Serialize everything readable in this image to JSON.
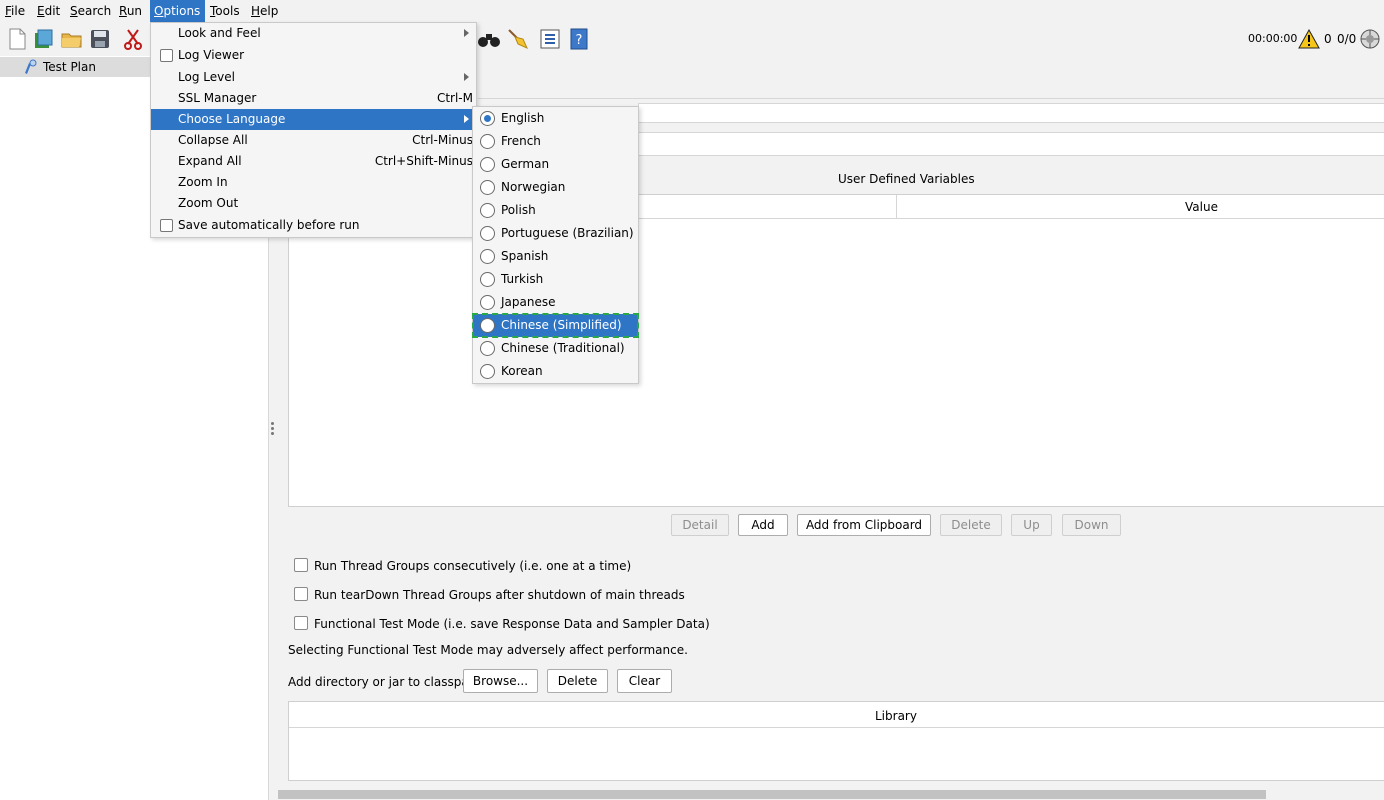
{
  "menubar": {
    "items": [
      {
        "mnemonic": "F",
        "rest": "ile"
      },
      {
        "mnemonic": "E",
        "rest": "dit"
      },
      {
        "mnemonic": "S",
        "rest": "earch"
      },
      {
        "mnemonic": "R",
        "rest": "un"
      },
      {
        "mnemonic": "O",
        "rest": "ptions"
      },
      {
        "mnemonic": "T",
        "rest": "ools"
      },
      {
        "mnemonic": "H",
        "rest": "elp"
      }
    ]
  },
  "status": {
    "timer": "00:00:00",
    "warnings": "0",
    "threads": "0/0"
  },
  "tree": {
    "root": "Test Plan"
  },
  "options_menu": {
    "items": [
      {
        "label": "Look and Feel",
        "accel": "",
        "submenu": true
      },
      {
        "label": "Log Viewer",
        "accel": "",
        "checkbox": true
      },
      {
        "label": "Log Level",
        "accel": "",
        "submenu": true
      },
      {
        "label": "SSL Manager",
        "accel": "Ctrl-M"
      },
      {
        "label": "Choose Language",
        "accel": "",
        "submenu": true,
        "highlighted": true
      },
      {
        "label": "Collapse All",
        "accel": "Ctrl-Minus"
      },
      {
        "label": "Expand All",
        "accel": "Ctrl+Shift-Minus"
      },
      {
        "label": "Zoom In",
        "accel": ""
      },
      {
        "label": "Zoom Out",
        "accel": ""
      },
      {
        "label": "Save automatically before run",
        "accel": "",
        "checkbox": true
      }
    ]
  },
  "language_menu": {
    "items": [
      "English",
      "French",
      "German",
      "Norwegian",
      "Polish",
      "Portuguese (Brazilian)",
      "Spanish",
      "Turkish",
      "Japanese",
      "Chinese (Simplified)",
      "Chinese (Traditional)",
      "Korean"
    ],
    "selected": "English",
    "highlighted": "Chinese (Simplified)"
  },
  "variables": {
    "title": "User Defined Variables",
    "col_value": "Value"
  },
  "buttons": {
    "detail": "Detail",
    "add": "Add",
    "add_clipboard": "Add from Clipboard",
    "delete": "Delete",
    "up": "Up",
    "down": "Down"
  },
  "options": {
    "run_consecutive": "Run Thread Groups consecutively (i.e. one at a time)",
    "run_teardown": "Run tearDown Thread Groups after shutdown of main threads",
    "functional": "Functional Test Mode (i.e. save Response Data and Sampler Data)",
    "functional_note": "Selecting Functional Test Mode may adversely affect performance."
  },
  "classpath": {
    "label": "Add directory or jar to classpath",
    "browse": "Browse...",
    "delete": "Delete",
    "clear": "Clear",
    "col_library": "Library"
  },
  "colors": {
    "accent": "#2e75c6",
    "focus": "#2aa845"
  }
}
